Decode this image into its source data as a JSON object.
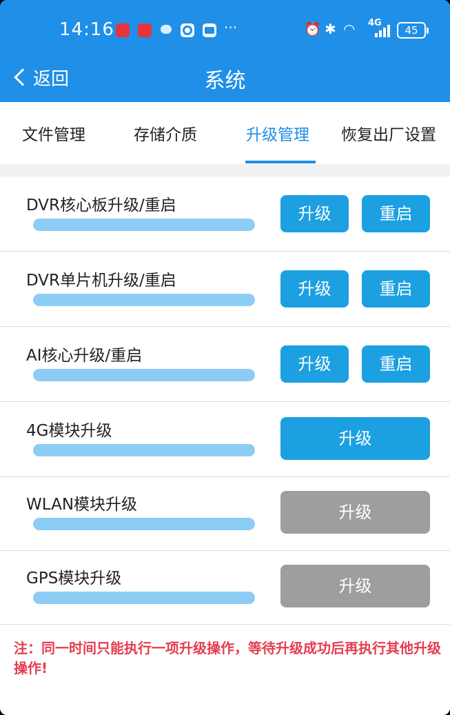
{
  "status_bar": {
    "time": "14:16",
    "network": "4G",
    "battery": "45",
    "more": "···"
  },
  "header": {
    "back_label": "返回",
    "title": "系统"
  },
  "tabs": [
    {
      "label": "文件管理",
      "active": false
    },
    {
      "label": "存储介质",
      "active": false
    },
    {
      "label": "升级管理",
      "active": true
    },
    {
      "label": "恢复出厂设置",
      "active": false
    }
  ],
  "rows": [
    {
      "label": "DVR核心板升级/重启",
      "upgrade_label": "升级",
      "restart_label": "重启",
      "progress": 1.0
    },
    {
      "label": "DVR单片机升级/重启",
      "upgrade_label": "升级",
      "restart_label": "重启",
      "progress": 1.0
    },
    {
      "label": "AI核心升级/重启",
      "upgrade_label": "升级",
      "restart_label": "重启",
      "progress": 1.0
    },
    {
      "label": "4G模块升级",
      "upgrade_label": "升级",
      "progress": 1.0,
      "enabled": true
    },
    {
      "label": "WLAN模块升级",
      "upgrade_label": "升级",
      "progress": 1.0,
      "enabled": false
    },
    {
      "label": "GPS模块升级",
      "upgrade_label": "升级",
      "progress": 1.0,
      "enabled": false
    }
  ],
  "note": "注：同一时间只能执行一项升级操作，等待升级成功后再执行其他升级操作!",
  "colors": {
    "header_blue": "#1f8fe8",
    "button_blue": "#1ca0e1",
    "button_disabled": "#9e9e9e",
    "progress": "#8dccf4",
    "note_red": "#e53d4f"
  }
}
